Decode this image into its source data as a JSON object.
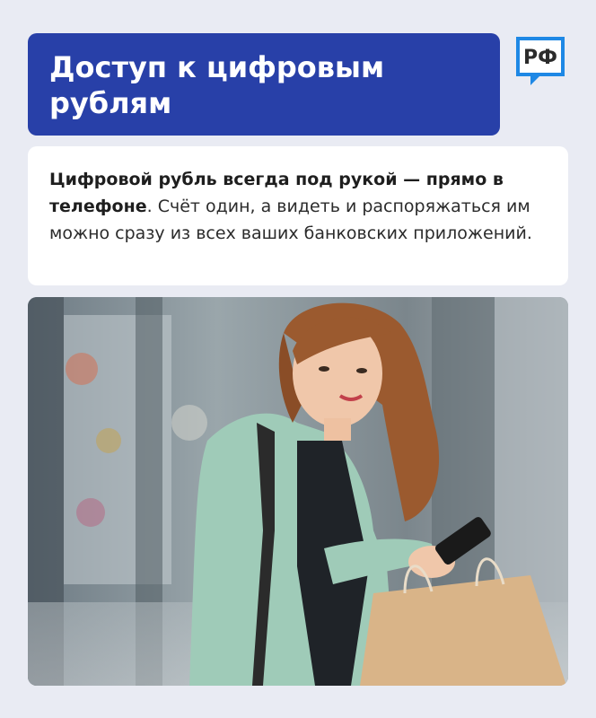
{
  "header": {
    "title": "Доступ к цифровым\nрублям",
    "logo_text": "РФ"
  },
  "body": {
    "bold": "Цифровой рубль всегда под рукой — прямо в телефоне",
    "rest": ". Счёт один, а видеть и распоряжаться им можно сразу из всех ваших банковских приложений."
  },
  "photo": {
    "icon": "woman-shopping-phone-photo"
  },
  "colors": {
    "title_bg": "#2840a8",
    "logo_accent": "#1e88e5",
    "page_bg": "#e9ebf3"
  }
}
